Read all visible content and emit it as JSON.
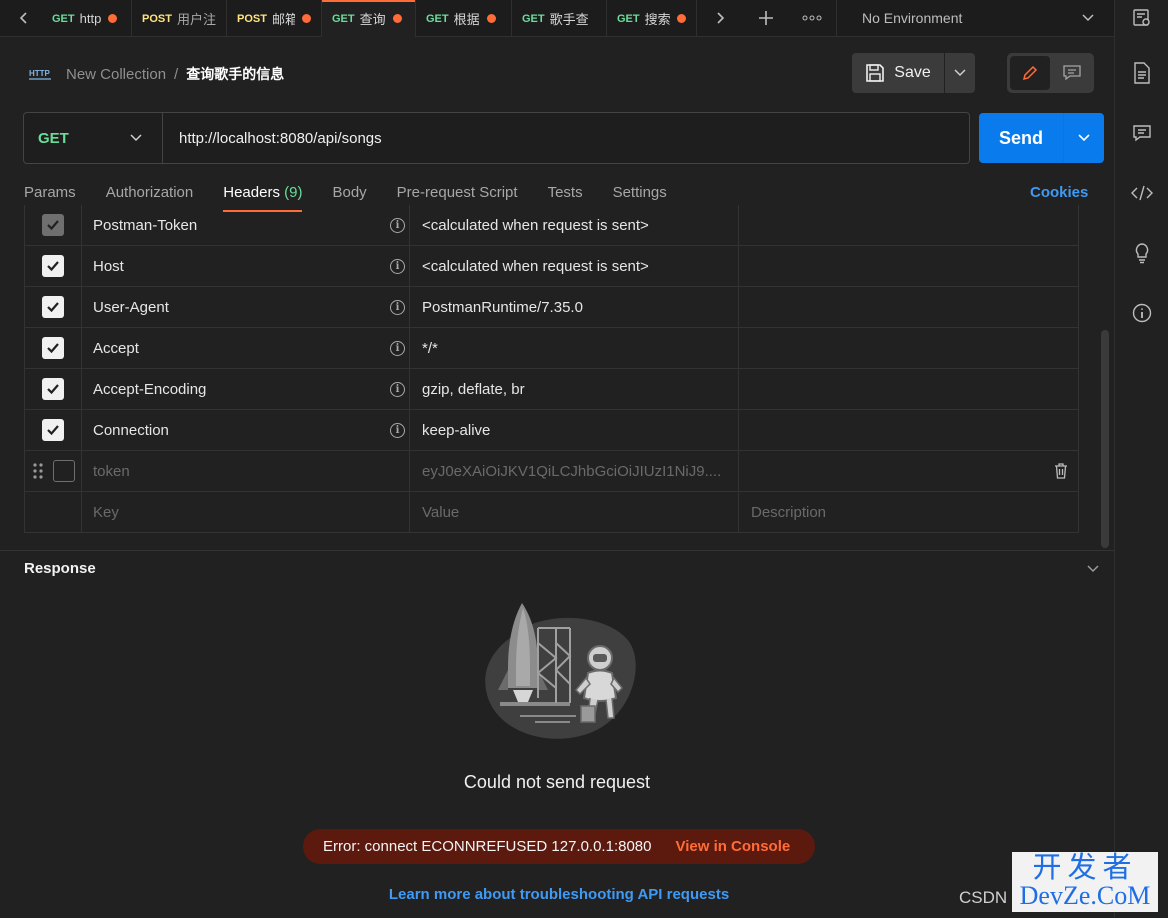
{
  "tabs": [
    {
      "method": "GET",
      "name": "http",
      "method_class": "get",
      "active": false
    },
    {
      "method": "POST",
      "name": "用户注",
      "method_class": "post",
      "active": false
    },
    {
      "method": "POST",
      "name": "邮箱",
      "method_class": "post",
      "active": false
    },
    {
      "method": "GET",
      "name": "查询",
      "method_class": "get",
      "active": true
    },
    {
      "method": "GET",
      "name": "根据",
      "method_class": "get",
      "active": false
    },
    {
      "method": "GET",
      "name": "歌手查",
      "method_class": "get",
      "active": false
    },
    {
      "method": "GET",
      "name": "搜索",
      "method_class": "get",
      "active": false
    }
  ],
  "environment": {
    "label": "No Environment"
  },
  "breadcrumb": {
    "collection": "New Collection",
    "separator": "/",
    "request": "查询歌手的信息"
  },
  "toolbar": {
    "save_label": "Save"
  },
  "request": {
    "method": "GET",
    "url": "http://localhost:8080/api/songs",
    "send_label": "Send"
  },
  "req_tabs": {
    "params": "Params",
    "authorization": "Authorization",
    "headers": "Headers",
    "headers_count": "(9)",
    "body": "Body",
    "prerequest": "Pre-request Script",
    "tests": "Tests",
    "settings": "Settings",
    "cookies": "Cookies"
  },
  "headers": [
    {
      "key": "Postman-Token",
      "value": "<calculated when request is sent>"
    },
    {
      "key": "Host",
      "value": "<calculated when request is sent>"
    },
    {
      "key": "User-Agent",
      "value": "PostmanRuntime/7.35.0"
    },
    {
      "key": "Accept",
      "value": "*/*"
    },
    {
      "key": "Accept-Encoding",
      "value": "gzip, deflate, br"
    },
    {
      "key": "Connection",
      "value": "keep-alive"
    },
    {
      "key": "token",
      "value": "eyJ0eXAiOiJKV1QiLCJhbGciOiJIUzI1NiJ9...."
    }
  ],
  "placeholder_row": {
    "key": "Key",
    "value": "Value",
    "description": "Description"
  },
  "response": {
    "title": "Response",
    "message": "Could not send request",
    "error": "Error: connect ECONNREFUSED 127.0.0.1:8080",
    "view_console": "View in Console",
    "learn_more": "Learn more about troubleshooting API requests"
  },
  "watermark": {
    "csdn": "CSDN",
    "line1": "开发者",
    "line2": "DevZe.CoM"
  },
  "colors": {
    "accent": "#ff6c37",
    "send": "#097bed",
    "get": "#6bdd9a",
    "post": "#ffe47e",
    "link": "#3f9af5"
  }
}
